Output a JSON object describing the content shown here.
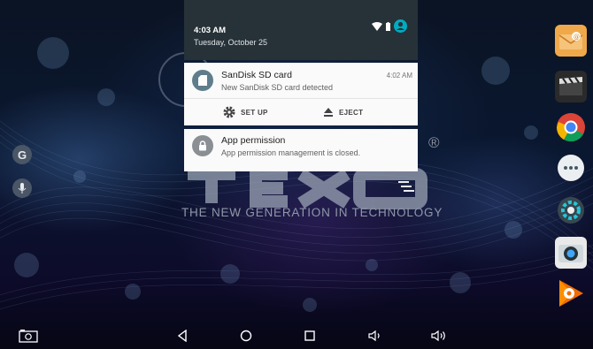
{
  "statusbar": {
    "time": "4:03 AM",
    "date": "Tuesday, October 25"
  },
  "notifications": [
    {
      "app": "SanDisk SD card",
      "text": "New SanDisk SD card detected",
      "time": "4:02 AM",
      "icon": "sd-card-icon",
      "actions": [
        {
          "label": "SET UP",
          "icon": "gear-icon"
        },
        {
          "label": "EJECT",
          "icon": "eject-icon"
        }
      ]
    },
    {
      "app": "App permission",
      "text": "App permission management is closed.",
      "icon": "lock-icon"
    }
  ],
  "wallpaper": {
    "tagline": "THE NEW GENERATION IN TECHNOLOGY",
    "registered": "®"
  },
  "left_shortcuts": [
    "google-icon",
    "microphone-icon"
  ],
  "apps": [
    "email-icon",
    "video-icon",
    "chrome-icon",
    "app-drawer-icon",
    "settings-icon",
    "camera-icon",
    "play-music-icon"
  ],
  "navbar": [
    "screenshot-icon",
    "back-icon",
    "home-icon",
    "recents-icon",
    "volume-down-icon",
    "volume-up-icon"
  ],
  "colors": {
    "shade": "#263238",
    "card": "#fafafa",
    "notif_icon": "#607d8b",
    "accent": "#00acc1"
  }
}
